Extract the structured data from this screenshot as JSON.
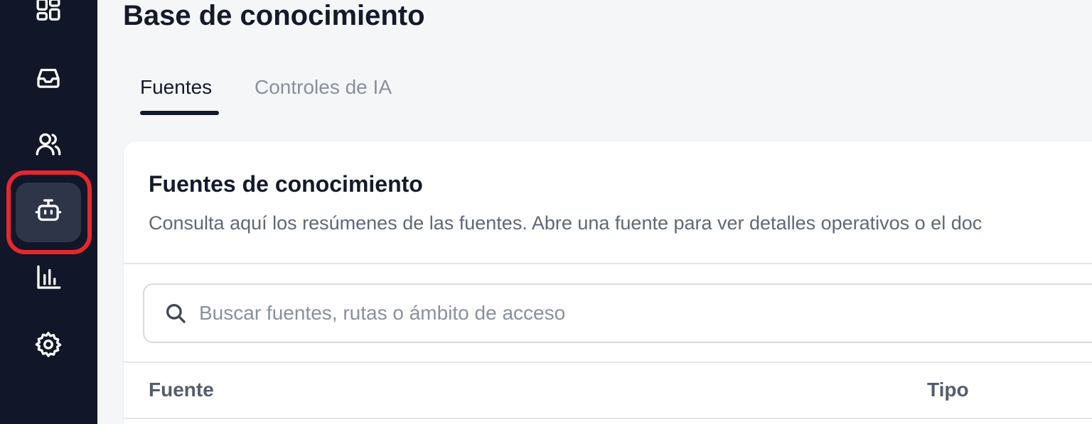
{
  "sidebar": {
    "items": [
      {
        "name": "dashboard",
        "icon": "dashboard-grid-icon",
        "active": false
      },
      {
        "name": "inbox",
        "icon": "inbox-icon",
        "active": false
      },
      {
        "name": "contacts",
        "icon": "users-icon",
        "active": false
      },
      {
        "name": "ai-agent",
        "icon": "bot-icon",
        "active": true
      },
      {
        "name": "reports",
        "icon": "bar-chart-icon",
        "active": false
      },
      {
        "name": "settings",
        "icon": "gear-icon",
        "active": false
      }
    ],
    "highlight_color": "#e8262d"
  },
  "header": {
    "title": "Base de conocimiento"
  },
  "tabs": [
    {
      "label": "Fuentes",
      "active": true
    },
    {
      "label": "Controles de IA",
      "active": false
    }
  ],
  "card": {
    "title": "Fuentes de conocimiento",
    "description": "Consulta aquí los resúmenes de las fuentes. Abre una fuente para ver detalles operativos o el doc",
    "search": {
      "placeholder": "Buscar fuentes, rutas o ámbito de acceso",
      "value": ""
    },
    "table": {
      "columns": [
        "Fuente",
        "Tipo"
      ]
    }
  },
  "colors": {
    "sidebar_bg": "#111729",
    "page_bg": "#f5f6f8",
    "text_primary": "#141a2b"
  }
}
